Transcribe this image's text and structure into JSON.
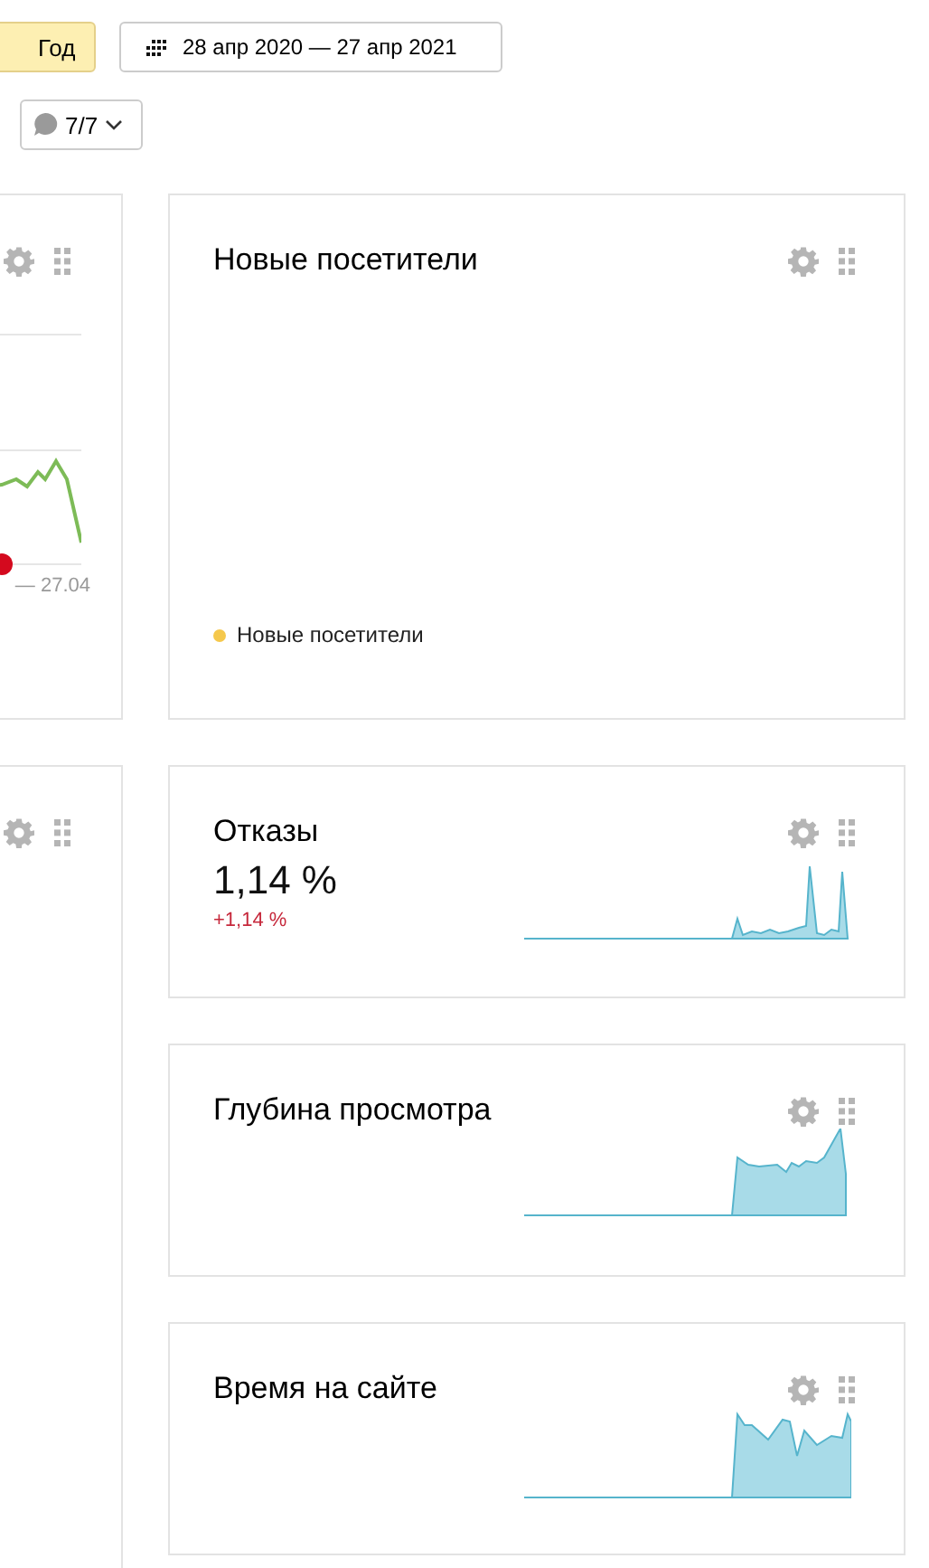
{
  "toolbar": {
    "period_buttons": [
      {
        "label": "Год",
        "selected": true
      }
    ],
    "date_range": "28 апр 2020 — 27 апр 2021",
    "comments": "7/7"
  },
  "left_widgets": [
    {
      "kind": "line",
      "axis_label": "— 27.04"
    },
    {
      "kind": "empty"
    }
  ],
  "widgets": [
    {
      "kind": "legend",
      "title": "Новые посетители",
      "legend": [
        {
          "label": "Новые посетители",
          "color": "#f5c84c"
        }
      ]
    },
    {
      "kind": "metric",
      "title": "Отказы",
      "value": "1,14 %",
      "delta": "+1,14 %"
    },
    {
      "kind": "sparkline",
      "title": "Глубина просмотра"
    },
    {
      "kind": "sparkline",
      "title": "Время на сайте"
    }
  ]
}
